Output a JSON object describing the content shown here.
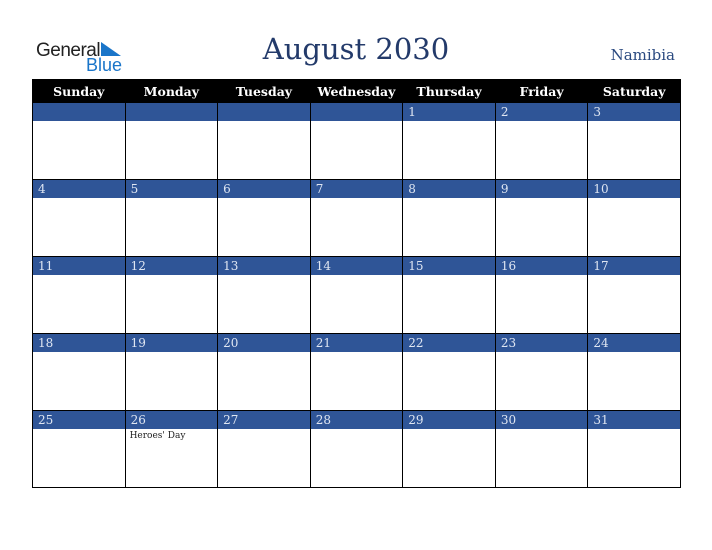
{
  "logo": {
    "line1": "General",
    "line2": "Blue"
  },
  "title": "August 2030",
  "country": "Namibia",
  "colors": {
    "header_bg": "#000000",
    "day_bar": "#2f5597",
    "title": "#233a6a",
    "logo_blue": "#1a75c9"
  },
  "weekdays": [
    "Sunday",
    "Monday",
    "Tuesday",
    "Wednesday",
    "Thursday",
    "Friday",
    "Saturday"
  ],
  "weeks": [
    [
      {
        "day": ""
      },
      {
        "day": ""
      },
      {
        "day": ""
      },
      {
        "day": ""
      },
      {
        "day": "1"
      },
      {
        "day": "2"
      },
      {
        "day": "3"
      }
    ],
    [
      {
        "day": "4"
      },
      {
        "day": "5"
      },
      {
        "day": "6"
      },
      {
        "day": "7"
      },
      {
        "day": "8"
      },
      {
        "day": "9"
      },
      {
        "day": "10"
      }
    ],
    [
      {
        "day": "11"
      },
      {
        "day": "12"
      },
      {
        "day": "13"
      },
      {
        "day": "14"
      },
      {
        "day": "15"
      },
      {
        "day": "16"
      },
      {
        "day": "17"
      }
    ],
    [
      {
        "day": "18"
      },
      {
        "day": "19"
      },
      {
        "day": "20"
      },
      {
        "day": "21"
      },
      {
        "day": "22"
      },
      {
        "day": "23"
      },
      {
        "day": "24"
      }
    ],
    [
      {
        "day": "25"
      },
      {
        "day": "26",
        "event": "Heroes' Day"
      },
      {
        "day": "27"
      },
      {
        "day": "28"
      },
      {
        "day": "29"
      },
      {
        "day": "30"
      },
      {
        "day": "31"
      }
    ]
  ]
}
